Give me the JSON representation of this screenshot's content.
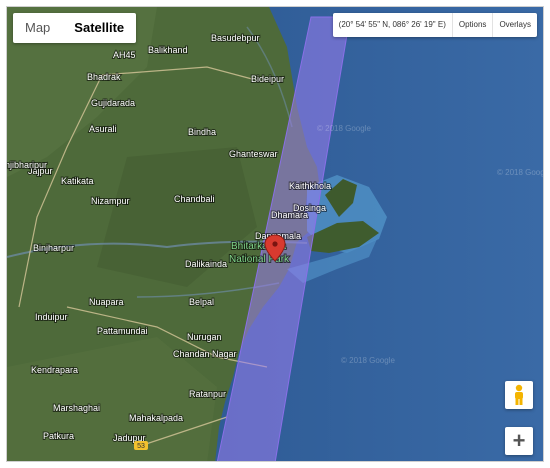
{
  "map_type": {
    "map_label": "Map",
    "satellite_label": "Satellite",
    "selected": "Satellite"
  },
  "toolbar": {
    "coordinates": "(20° 54' 55\" N, 086° 26' 19\" E)",
    "options_label": "Options",
    "overlays_label": "Overlays"
  },
  "zoom": {
    "in_label": "+"
  },
  "map": {
    "places": [
      "Basudebpur",
      "Balikhand",
      "Bhadrak",
      "Bideipur",
      "Gujidarada",
      "Asurali",
      "Bindha",
      "Ghanteswar",
      "Jajpur",
      "Katikata",
      "Nizampur",
      "Chandbali",
      "Kaithkhola",
      "Dosinga",
      "Dhamara",
      "Dangamala",
      "Binjharpur",
      "Dalikainda",
      "Belpal",
      "Nuapara",
      "Induipur",
      "Pattamundai",
      "Nurugan",
      "Chandan Nagar",
      "Kendrapara",
      "Ratanpur",
      "Marshaghai",
      "Mahakalpada",
      "Patkura",
      "Jadupur"
    ],
    "partial_places": [
      "njibharipur",
      "AH45"
    ],
    "park_label_1": "Bhitarkanika",
    "park_label_2": "National Park",
    "water_marks": [
      "© 2018 Google",
      "© 2018 Google",
      "© 2018 Google"
    ],
    "road_shield": "53",
    "colors": {
      "land": "#4e6a3a",
      "sea": "#2f5c96",
      "shallow": "#4f8fc4",
      "swath": "#9a7ef0",
      "marker": "#d83a2f"
    }
  }
}
